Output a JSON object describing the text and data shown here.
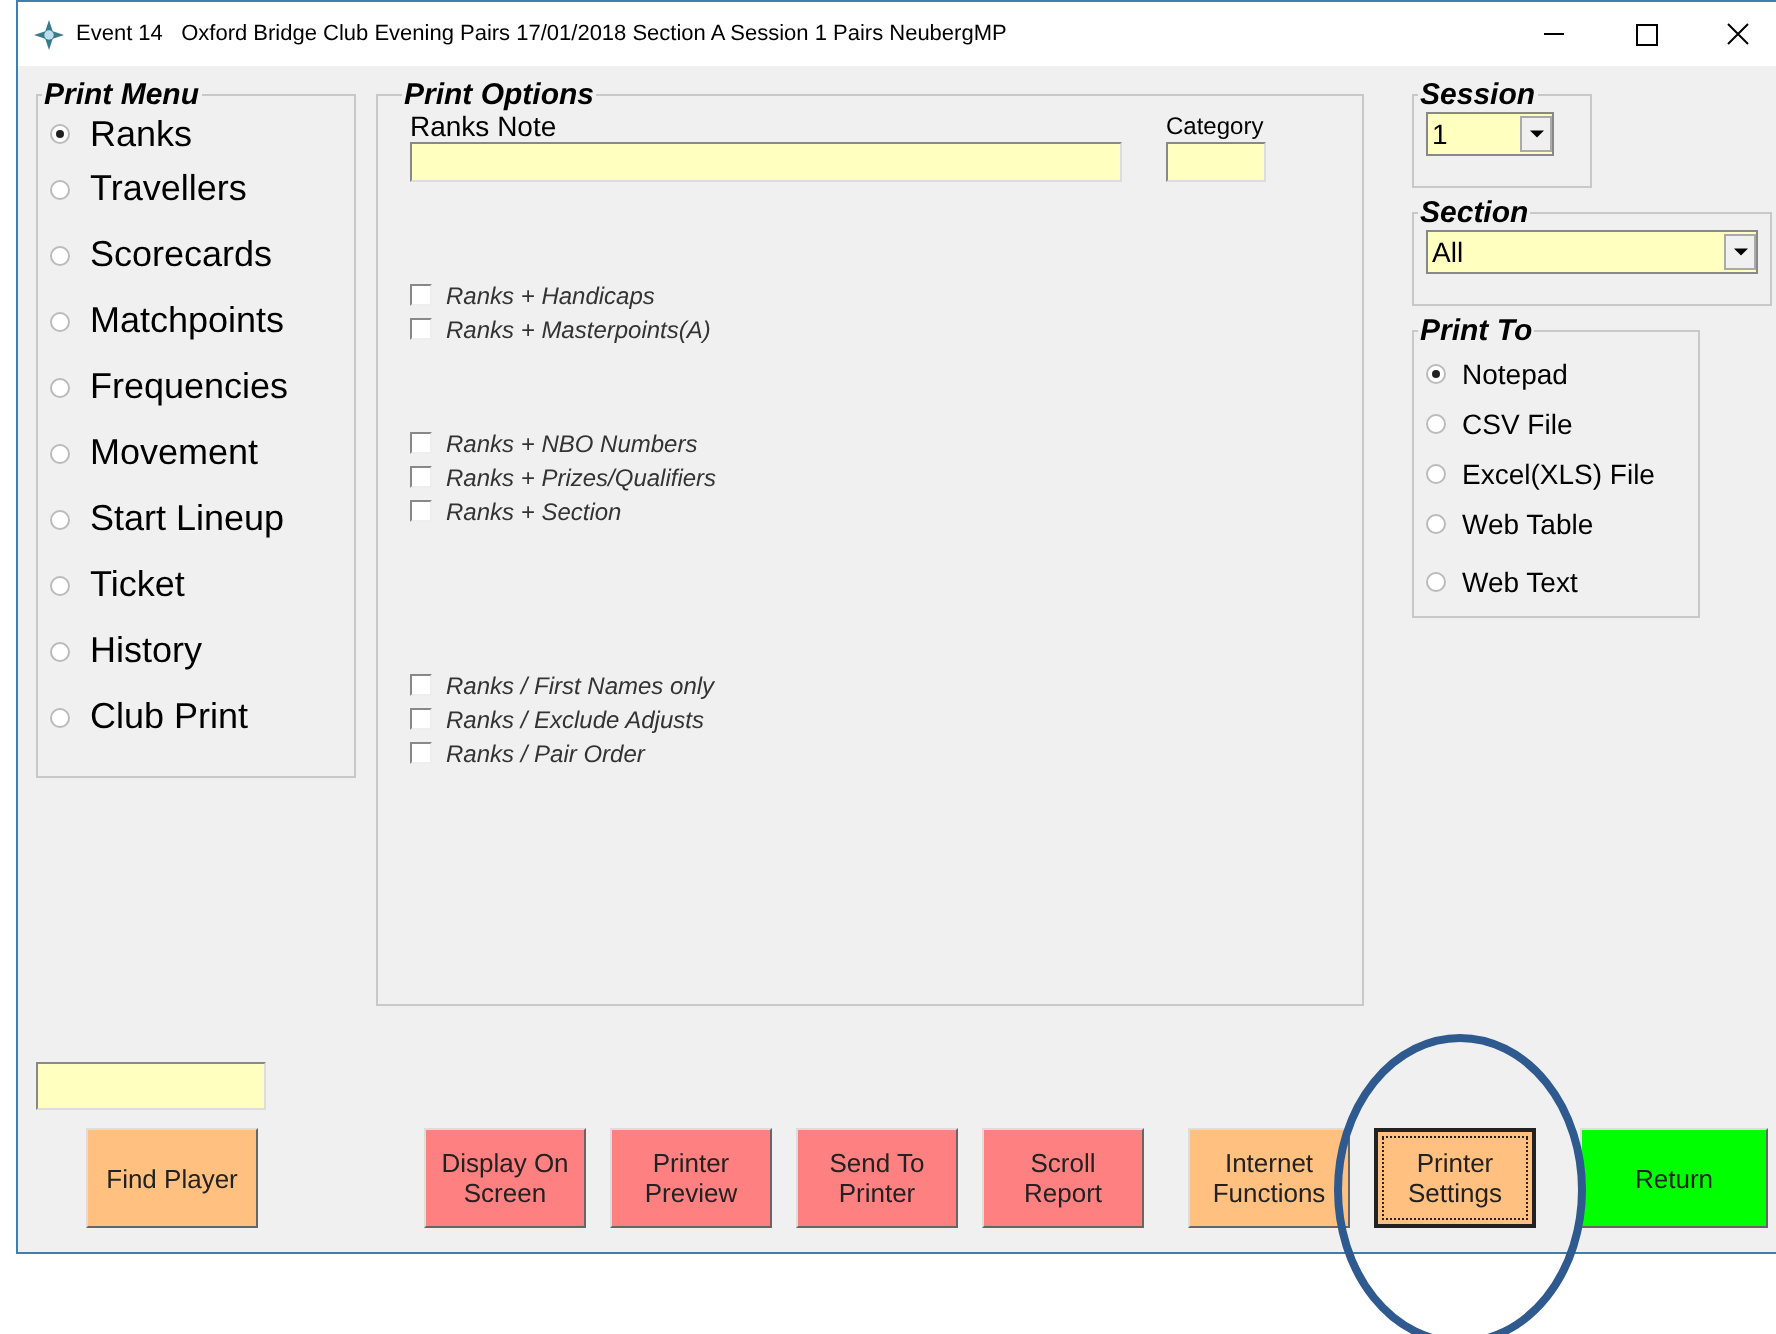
{
  "window": {
    "title": "Event 14   Oxford Bridge Club Evening Pairs 17/01/2018 Section A Session 1 Pairs NeubergMP"
  },
  "print_menu": {
    "title": "Print Menu",
    "items": [
      {
        "label": "Ranks",
        "selected": true
      },
      {
        "label": "Travellers",
        "selected": false
      },
      {
        "label": "Scorecards",
        "selected": false
      },
      {
        "label": "Matchpoints",
        "selected": false
      },
      {
        "label": "Frequencies",
        "selected": false
      },
      {
        "label": "Movement",
        "selected": false
      },
      {
        "label": "Start Lineup",
        "selected": false
      },
      {
        "label": "Ticket",
        "selected": false
      },
      {
        "label": "History",
        "selected": false
      },
      {
        "label": "Club Print",
        "selected": false
      }
    ]
  },
  "print_options": {
    "title": "Print Options",
    "note_label": "Ranks Note",
    "category_label": "Category",
    "option_groups": [
      [
        {
          "label": "Ranks + Handicaps",
          "checked": false
        },
        {
          "label": "Ranks + Masterpoints(A)",
          "checked": false
        }
      ],
      [
        {
          "label": "Ranks + NBO Numbers",
          "checked": false
        },
        {
          "label": "Ranks + Prizes/Qualifiers",
          "checked": false
        },
        {
          "label": "Ranks + Section",
          "checked": false
        }
      ],
      [
        {
          "label": "Ranks / First Names only",
          "checked": false
        },
        {
          "label": "Ranks / Exclude Adjusts",
          "checked": false
        },
        {
          "label": "Ranks / Pair Order",
          "checked": false
        }
      ]
    ]
  },
  "session": {
    "title": "Session",
    "value": "1"
  },
  "section": {
    "title": "Section",
    "value": "All"
  },
  "print_to": {
    "title": "Print To",
    "items": [
      {
        "label": "Notepad",
        "selected": true
      },
      {
        "label": "CSV File",
        "selected": false
      },
      {
        "label": "Excel(XLS) File",
        "selected": false
      },
      {
        "label": "Web Table",
        "selected": false
      },
      {
        "label": "Web Text",
        "selected": false
      }
    ]
  },
  "buttons": [
    {
      "label": "Find Player",
      "color": "#ffc080",
      "focused": false
    },
    {
      "label": "Display On Screen",
      "color": "#ff8080",
      "focused": false
    },
    {
      "label": "Printer Preview",
      "color": "#ff8080",
      "focused": false
    },
    {
      "label": "Send To Printer",
      "color": "#ff8080",
      "focused": false
    },
    {
      "label": "Scroll Report",
      "color": "#ff8080",
      "focused": false
    },
    {
      "label": "Internet Functions",
      "color": "#ffc080",
      "focused": false
    },
    {
      "label": "Printer Settings",
      "color": "#ffc080",
      "focused": true
    },
    {
      "label": "Return",
      "color": "#00ff00",
      "focused": false
    }
  ]
}
